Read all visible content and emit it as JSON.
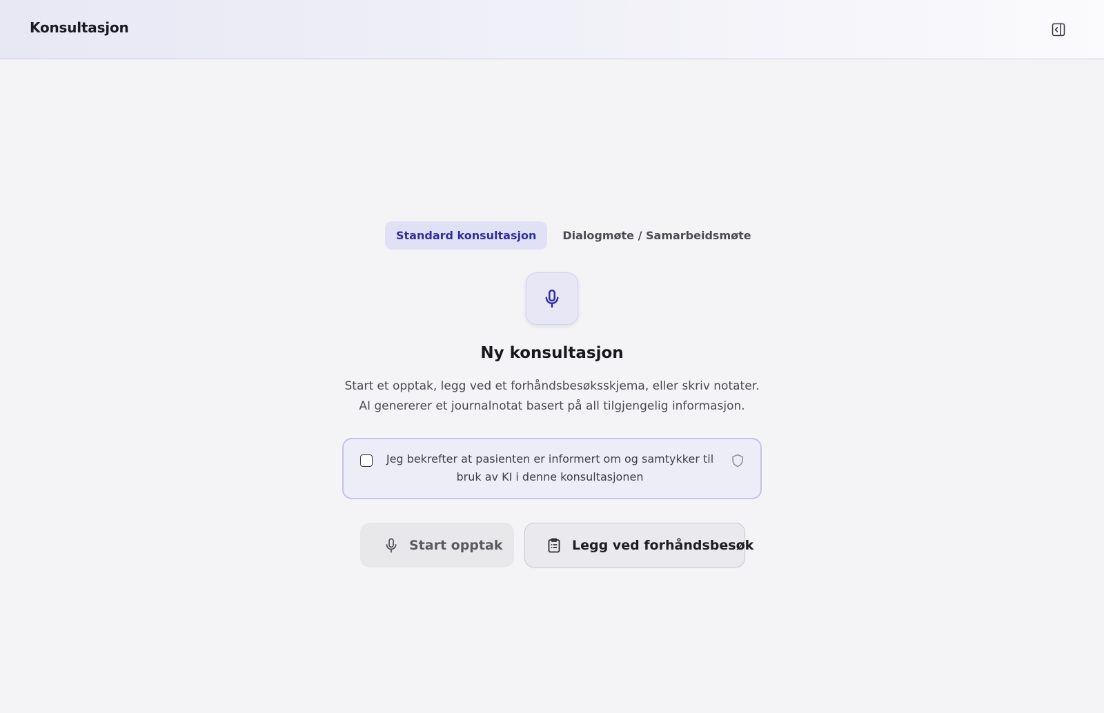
{
  "header": {
    "title": "Konsultasjon"
  },
  "tabs": [
    {
      "label": "Standard konsultasjon",
      "active": true
    },
    {
      "label": "Dialogmøte / Samarbeidsmøte",
      "active": false
    }
  ],
  "main": {
    "title": "Ny konsultasjon",
    "description": "Start et opptak, legg ved et forhåndsbesøksskjema, eller skriv notater. AI genererer et journalnotat basert på all tilgjengelig informasjon.",
    "consent": {
      "text": "Jeg bekrefter at pasienten er informert om og samtykker til bruk av KI i denne konsultasjonen",
      "checked": false
    },
    "buttons": {
      "start_recording": "Start opptak",
      "attach_previsit": "Legg ved forhåndsbesøk"
    }
  },
  "icons": {
    "panel_toggle": "sidebar-collapse-icon",
    "mic": "microphone-icon",
    "shield": "shield-icon",
    "clipboard": "clipboard-list-icon"
  },
  "colors": {
    "accent": "#2e2f9c",
    "tab_active_bg": "#e1e1f5",
    "consent_border": "#c3c4e6",
    "background": "#f4f4f6"
  }
}
